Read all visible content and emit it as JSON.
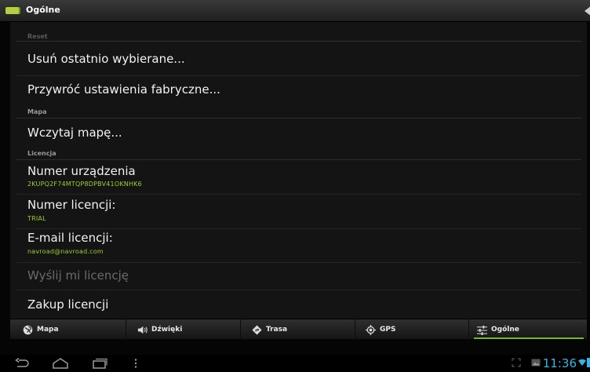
{
  "actionbar": {
    "title": "Ogólne",
    "app_icon": "map-icon",
    "back_icon": "back-arrow-icon"
  },
  "sections": {
    "reset": {
      "header": "Reset"
    },
    "mapa": {
      "header": "Mapa"
    },
    "licencja": {
      "header": "Licencja"
    }
  },
  "items": {
    "clear_recent": {
      "title": "Usuń ostatnio wybierane..."
    },
    "factory_reset": {
      "title": "Przywróć ustawienia fabryczne..."
    },
    "load_map": {
      "title": "Wczytaj mapę..."
    },
    "device_number": {
      "title": "Numer urządzenia",
      "value": "2KUPQ2F74MTQP8DPBV41OKNHK6"
    },
    "license_number": {
      "title": "Numer licencji:",
      "value": "TRIAL"
    },
    "license_email": {
      "title": "E-mail licencji:",
      "value": "navroad@navroad.com"
    },
    "send_license": {
      "title": "Wyślij mi licencję",
      "enabled": false
    },
    "buy_license": {
      "title": "Zakup licencji"
    }
  },
  "tabs": [
    {
      "label": "Mapa",
      "icon": "globe-icon",
      "selected": false
    },
    {
      "label": "Dźwięki",
      "icon": "speaker-icon",
      "selected": false
    },
    {
      "label": "Trasa",
      "icon": "route-diamond-icon",
      "selected": false
    },
    {
      "label": "GPS",
      "icon": "gps-target-icon",
      "selected": false
    },
    {
      "label": "Ogólne",
      "icon": "sliders-icon",
      "selected": true
    }
  ],
  "navbar": {
    "buttons": [
      "back-icon",
      "home-icon",
      "recent-apps-icon",
      "menu-icon"
    ],
    "status_icons": [
      "screenshot-icon",
      "gallery-icon",
      "wifi-icon",
      "battery-icon"
    ],
    "time": "11:36"
  },
  "colors": {
    "accent_green": "#9ccf2a",
    "clock_blue": "#33b5e5",
    "panel_bg": "#141414"
  }
}
